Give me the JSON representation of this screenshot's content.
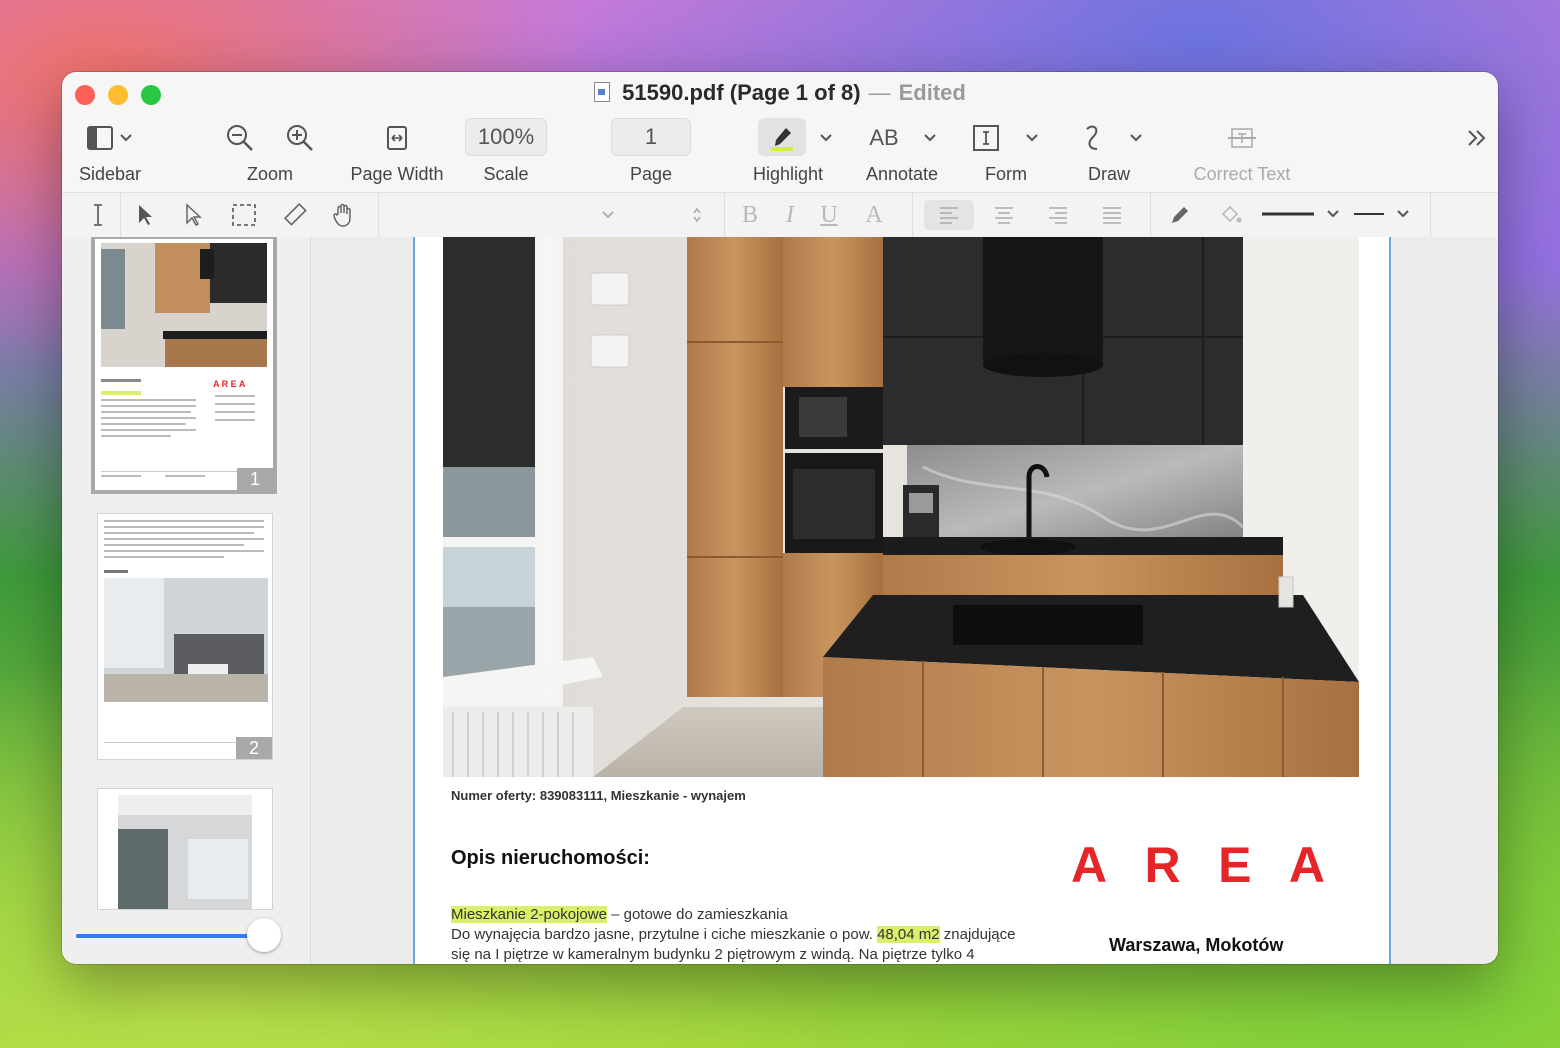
{
  "window": {
    "file_name": "51590.pdf (Page 1 of 8)",
    "separator": "—",
    "status": "Edited"
  },
  "toolbar": {
    "sidebar_label": "Sidebar",
    "zoom_label": "Zoom",
    "page_width_label": "Page Width",
    "scale_label": "Scale",
    "scale_value": "100%",
    "page_label": "Page",
    "page_value": "1",
    "highlight_label": "Highlight",
    "annotate_label": "Annotate",
    "annotate_icon_text": "AB",
    "form_label": "Form",
    "draw_label": "Draw",
    "correct_text_label": "Correct Text"
  },
  "formatbar": {
    "bold": "B",
    "italic": "I",
    "underline": "U",
    "font_color": "A"
  },
  "sidebar": {
    "thumbnails": [
      {
        "number": "1",
        "selected": true
      },
      {
        "number": "2",
        "selected": false
      },
      {
        "number": "",
        "selected": false
      }
    ],
    "thumb_size_fraction": 0.94
  },
  "document": {
    "caption": "Numer oferty: 839083111, Mieszkanie - wynajem",
    "heading": "Opis nieruchomości:",
    "line1_highlight": "Mieszkanie 2-pokojowe",
    "line1_rest": " – gotowe do zamieszkania",
    "line2_start": "Do wynajęcia bardzo jasne, przytulne i ciche mieszkanie o pow. ",
    "line2_highlight": "48,04 m2",
    "line2_end": " znajdujące",
    "line3": "się na I piętrze w kameralnym budynku 2 piętrowym z windą. Na piętrze tylko 4",
    "logo_letters": [
      "A",
      "R",
      "E",
      "A"
    ],
    "location": "Warszawa, Mokotów"
  },
  "colors": {
    "accent": "#2f7cf6",
    "logo_red": "#e52629",
    "highlight": "#d9f06a"
  }
}
